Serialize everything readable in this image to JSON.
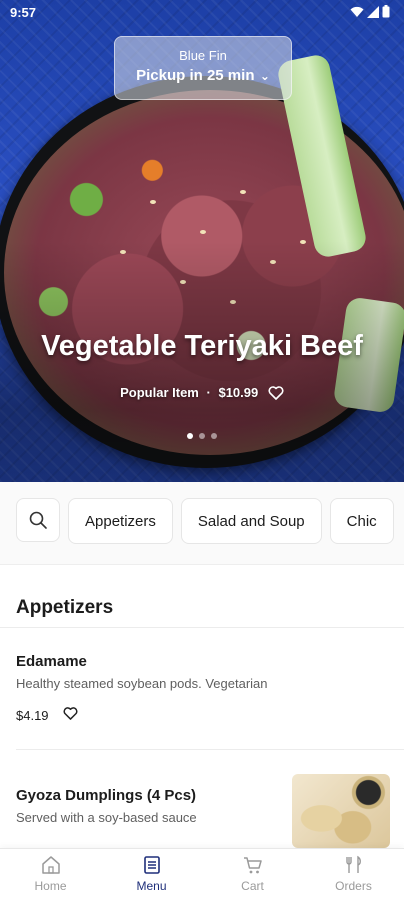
{
  "status_bar": {
    "time": "9:57"
  },
  "hero": {
    "store_name": "Blue Fin",
    "pickup_text": "Pickup in 25 min",
    "title": "Vegetable Teriyaki Beef",
    "badge": "Popular Item",
    "price": "$10.99",
    "carousel_count": 3,
    "carousel_active": 1
  },
  "categories": [
    "Appetizers",
    "Salad and Soup",
    "Chic"
  ],
  "section": {
    "title": "Appetizers"
  },
  "items": [
    {
      "name": "Edamame",
      "description": "Healthy steamed soybean pods. Vegetarian",
      "price": "$4.19"
    },
    {
      "name": "Gyoza Dumplings (4 Pcs)",
      "description": "Served with a soy-based sauce"
    }
  ],
  "bottom_nav": [
    {
      "label": "Home",
      "icon": "home-icon"
    },
    {
      "label": "Menu",
      "icon": "menu-icon"
    },
    {
      "label": "Cart",
      "icon": "cart-icon"
    },
    {
      "label": "Orders",
      "icon": "orders-icon"
    }
  ],
  "bottom_nav_active": "Menu",
  "colors": {
    "accent": "#1f2f7a",
    "hero_blue": "#2a4fc2"
  }
}
